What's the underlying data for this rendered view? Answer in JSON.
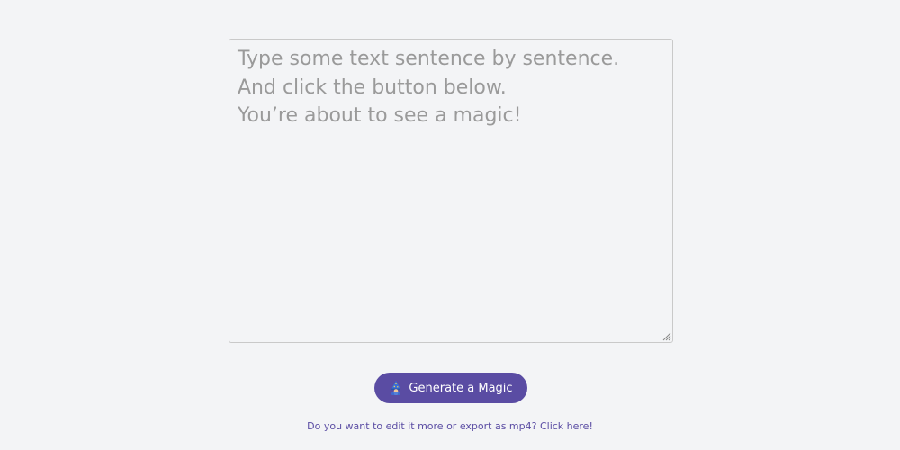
{
  "editor": {
    "placeholder": "Type some text sentence by sentence.\nAnd click the button below.\nYou’re about to see a magic!",
    "value": ""
  },
  "generate_button": {
    "icon": "wizard-icon",
    "label": "Generate a Magic"
  },
  "edit_link": {
    "label": "Do you want to edit it more or export as mp4? Click here!"
  },
  "colors": {
    "background": "#f3f4f6",
    "accent": "#5a4ca3",
    "placeholder_text": "#9a9a9a",
    "border": "#c9c9c9"
  }
}
